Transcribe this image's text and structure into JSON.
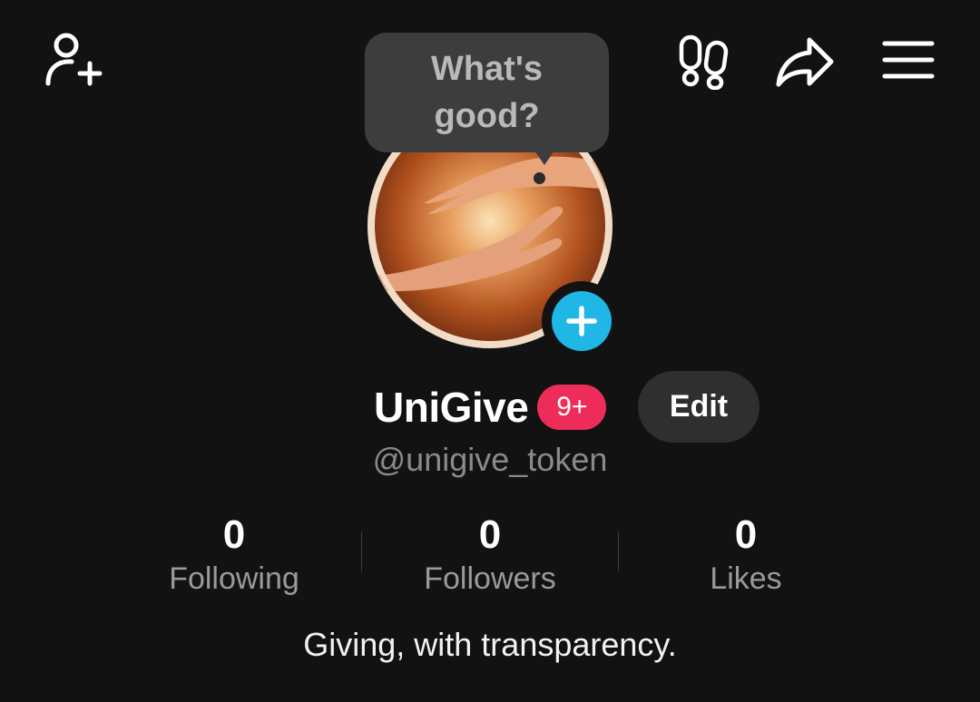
{
  "header": {
    "add_friend_icon": "person-plus-icon",
    "footprints_icon": "footprints-icon",
    "share_icon": "share-arrow-icon",
    "menu_icon": "hamburger-menu-icon"
  },
  "status_bubble": {
    "text": "What's good?"
  },
  "profile": {
    "avatar": "hands-avatar",
    "add_icon": "plus-icon",
    "name": "UniGive",
    "notification_badge": "9+",
    "edit_label": "Edit",
    "handle": "@unigive_token",
    "bio": "Giving, with transparency."
  },
  "stats": [
    {
      "value": "0",
      "label": "Following"
    },
    {
      "value": "0",
      "label": "Followers"
    },
    {
      "value": "0",
      "label": "Likes"
    }
  ],
  "colors": {
    "background": "#121212",
    "badge_red": "#ee2c5a",
    "accent_blue": "#20b6e6",
    "button_gray": "#2f2f2f",
    "bubble_gray": "#3d3d3d"
  }
}
